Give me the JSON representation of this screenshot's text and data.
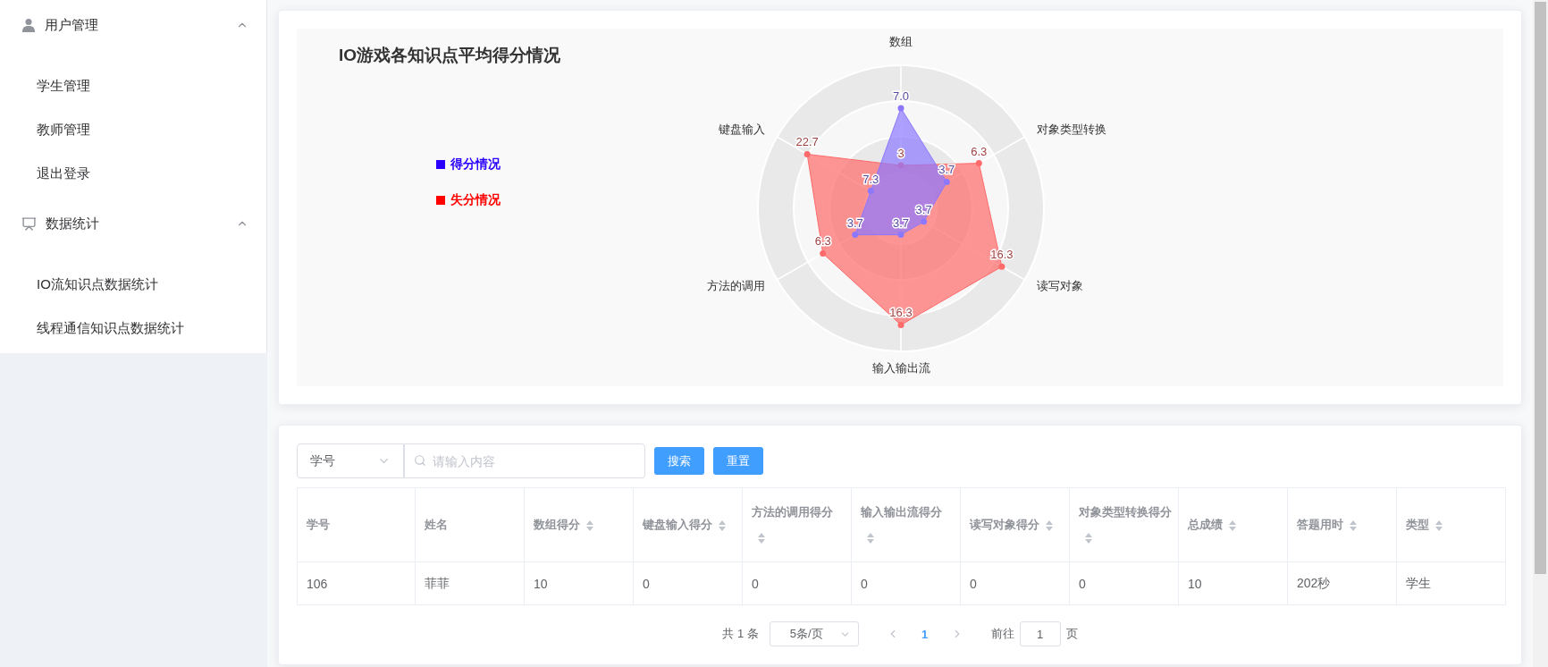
{
  "sidebar": {
    "groups": [
      {
        "title": "用户管理",
        "expanded": true,
        "items": [
          {
            "label": "学生管理"
          },
          {
            "label": "教师管理"
          },
          {
            "label": "退出登录"
          }
        ]
      },
      {
        "title": "数据统计",
        "expanded": true,
        "items": [
          {
            "label": "IO流知识点数据统计"
          },
          {
            "label": "线程通信知识点数据统计"
          }
        ]
      }
    ]
  },
  "radar_chart": {
    "title": "IO游戏各知识点平均得分情况",
    "axes": [
      "数组",
      "对象类型转换",
      "读写对象",
      "输入输出流",
      "方法的调用",
      "键盘输入"
    ],
    "legend": [
      {
        "label": "得分情况",
        "color": "#2b00ff"
      },
      {
        "label": "失分情况",
        "color": "#ff0000"
      }
    ],
    "series": [
      {
        "color": "#ff6a6a",
        "labels": [
          "3",
          "6.3",
          "16.3",
          "16.3",
          "6.3",
          "22.7"
        ]
      },
      {
        "color": "#8b78ff",
        "labels": [
          "7.0",
          "3.7",
          "3.7",
          "3.7",
          "3.7",
          "7.3"
        ]
      }
    ]
  },
  "filter": {
    "field_select": "学号",
    "search": {
      "placeholder": "请输入内容"
    },
    "buttons": [
      "搜索",
      "重置"
    ]
  },
  "table": {
    "columns": [
      {
        "label": "学号",
        "sortable": false
      },
      {
        "label": "姓名",
        "sortable": false
      },
      {
        "label": "数组得分",
        "sortable": true
      },
      {
        "label": "键盘输入得分",
        "sortable": true
      },
      {
        "label": "方法的调用得分",
        "sortable": true
      },
      {
        "label": "输入输出流得分",
        "sortable": true
      },
      {
        "label": "读写对象得分",
        "sortable": true
      },
      {
        "label": "对象类型转换得分",
        "sortable": true
      },
      {
        "label": "总成绩",
        "sortable": true
      },
      {
        "label": "答题用时",
        "sortable": true
      },
      {
        "label": "类型",
        "sortable": true
      }
    ],
    "rows": [
      [
        "106",
        "菲菲",
        "10",
        "0",
        "0",
        "0",
        "0",
        "0",
        "10",
        "202秒",
        "学生"
      ]
    ]
  },
  "pagination": {
    "total": "共 1 条",
    "page_size": "5条/页",
    "pages": [
      {
        "label": "1",
        "selected": true
      }
    ],
    "goto_label": "前往",
    "goto_value": "1",
    "page_suffix": "页"
  }
}
